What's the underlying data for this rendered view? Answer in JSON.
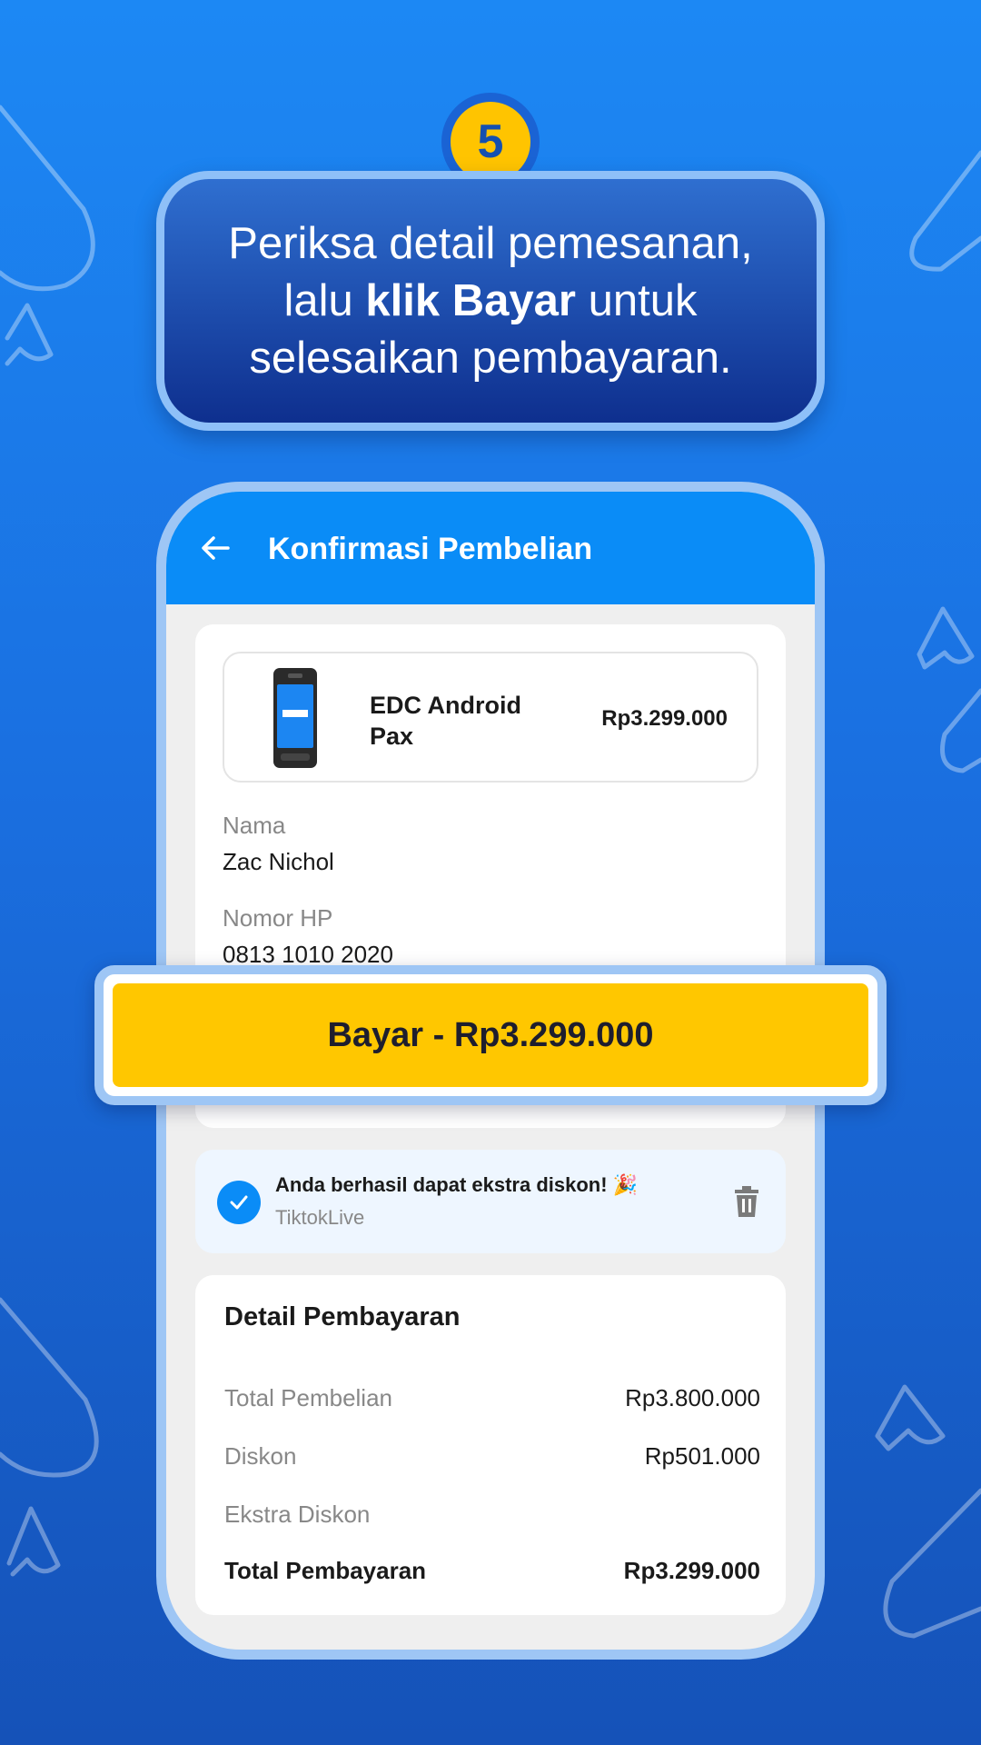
{
  "step": {
    "number": "5"
  },
  "instruction": {
    "line1": "Periksa detail pemesanan,",
    "line2_pre": "lalu ",
    "line2_bold": "klik Bayar",
    "line2_post": " untuk",
    "line3": "selesaikan pembayaran."
  },
  "header": {
    "title": "Konfirmasi Pembelian",
    "back_icon": "arrow-left-icon"
  },
  "product": {
    "name": "EDC Android Pax",
    "price": "Rp3.299.000",
    "image_icon": "edc-device-icon"
  },
  "customer": {
    "name_label": "Nama",
    "name_value": "Zac Nichol",
    "phone_label": "Nomor HP",
    "phone_value": "0813 1010 2020"
  },
  "pay_button": {
    "label": "Bayar - Rp3.299.000",
    "color": "#ffc700"
  },
  "promo": {
    "title": "Anda berhasil dapat ekstra diskon! 🎉",
    "code": "TiktokLive",
    "check_icon": "check-circle-icon",
    "delete_icon": "trash-icon"
  },
  "payment_details": {
    "title": "Detail Pembayaran",
    "rows": [
      {
        "label": "Total Pembelian",
        "value": "Rp3.800.000"
      },
      {
        "label": "Diskon",
        "value": "Rp501.000"
      },
      {
        "label": "Ekstra Diskon",
        "value": ""
      },
      {
        "label": "Total Pembayaran",
        "value": "Rp3.299.000"
      }
    ]
  },
  "colors": {
    "header_blue": "#0a8cf7",
    "accent_yellow": "#ffc700",
    "background_blue": "#1a6fe0"
  }
}
